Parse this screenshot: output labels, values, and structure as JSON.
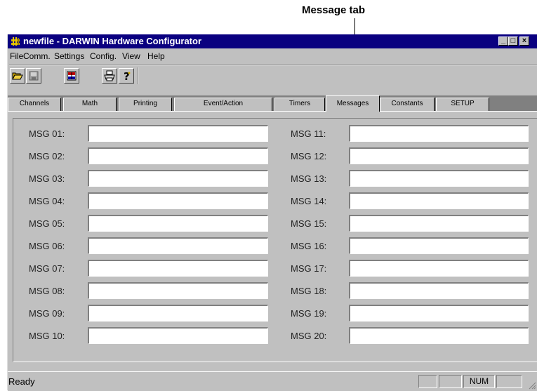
{
  "callout": {
    "label": "Message tab"
  },
  "window": {
    "title": "newfile - DARWIN Hardware Configurator"
  },
  "window_controls": {
    "minimize": "_",
    "maximize": "□",
    "close": "×"
  },
  "menu": [
    "File",
    "Comm.",
    "Settings",
    "Config.",
    "View",
    "Help"
  ],
  "toolbar": [
    "open-folder-icon",
    "save-disk-icon",
    "communication-icon",
    "print-icon",
    "help-icon"
  ],
  "tabs": [
    "Channels",
    "Math",
    "Printing",
    "Event/Action",
    "Timers",
    "Messages",
    "Constants",
    "SETUP"
  ],
  "active_tab": "Messages",
  "messages": {
    "left": [
      {
        "label": "MSG 01:",
        "value": ""
      },
      {
        "label": "MSG 02:",
        "value": ""
      },
      {
        "label": "MSG 03:",
        "value": ""
      },
      {
        "label": "MSG 04:",
        "value": ""
      },
      {
        "label": "MSG 05:",
        "value": ""
      },
      {
        "label": "MSG 06:",
        "value": ""
      },
      {
        "label": "MSG 07:",
        "value": ""
      },
      {
        "label": "MSG 08:",
        "value": ""
      },
      {
        "label": "MSG 09:",
        "value": ""
      },
      {
        "label": "MSG 10:",
        "value": ""
      }
    ],
    "right": [
      {
        "label": "MSG 11:",
        "value": ""
      },
      {
        "label": "MSG 12:",
        "value": ""
      },
      {
        "label": "MSG 13:",
        "value": ""
      },
      {
        "label": "MSG 14:",
        "value": ""
      },
      {
        "label": "MSG 15:",
        "value": ""
      },
      {
        "label": "MSG 16:",
        "value": ""
      },
      {
        "label": "MSG 17:",
        "value": ""
      },
      {
        "label": "MSG 18:",
        "value": ""
      },
      {
        "label": "MSG 19:",
        "value": ""
      },
      {
        "label": "MSG 20:",
        "value": ""
      }
    ]
  },
  "status": {
    "text": "Ready",
    "panes": [
      "",
      "",
      "NUM",
      ""
    ]
  },
  "colors": {
    "titlebar": "#0a0080",
    "face": "#c0c0c0",
    "tab_strip": "#808080"
  }
}
